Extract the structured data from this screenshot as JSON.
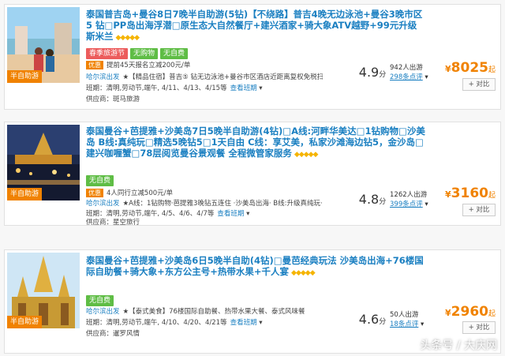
{
  "listings": [
    {
      "title": "泰国普吉岛+曼谷8日7晚半自助游(5钻)【不绕路】普吉4晚无边泳池+曼谷3晚市区5 钻□PP岛出海浮潜□原生态大自然餐厅+建兴酒家+骑大象ATV越野+99元升级斯米兰",
      "badge": "半自助游",
      "chips": [
        {
          "label": "春季旅游节",
          "color": "red"
        },
        {
          "label": "无购物",
          "color": "green"
        },
        {
          "label": "无自费",
          "color": "green"
        }
      ],
      "promo_tag": "优惠",
      "promo_text": "提前45天报名立减200元/单",
      "depart": "哈尔滨出发",
      "desc": "★【精品住宿】普吉⑤ 钻无边泳池+曼谷市区酒店近距离复权免税扫货!",
      "schedule_prefix": "班期：",
      "schedule": "清明,劳动节,端午, 4/11、4/13、4/15等",
      "schedule_link": "查看班期",
      "supplier_prefix": "供应商：",
      "supplier": "斑马旅游",
      "score": "4.9",
      "score_unit": "分",
      "travelers": "942人出游",
      "reviews": "298条点评",
      "price_cur": "¥",
      "price": "8025",
      "price_suffix": "起",
      "compare_label": "+ 对比"
    },
    {
      "title": "泰国曼谷+芭提雅+沙美岛7日5晚半自助游(4钻)□A线:河畔华美达□1钻购物□沙美岛 B线:真纯玩□精选5晚钻5□1天自由 C线：享艾美，私家沙滩海边钻5，金沙岛□建兴咖喱蟹□78层阅览曼谷景观餐 全程微管家服务",
      "badge": "半自助游",
      "chips": [
        {
          "label": "无自费",
          "color": "green"
        }
      ],
      "promo_tag": "优惠",
      "promo_text": "4人同行立减500元/单",
      "depart": "哈尔滨出发",
      "desc": "★A线：1钻购物·芭提雅3晚钻五连住 ·沙美岛出海· B线:升级真纯玩··1天自由·",
      "schedule_prefix": "班期：",
      "schedule": "清明,劳动节,端午, 4/5、4/6、4/7等",
      "schedule_link": "查看班期",
      "supplier_prefix": "供应商：",
      "supplier": "星空旅行",
      "score": "4.8",
      "score_unit": "分",
      "travelers": "1262人出游",
      "reviews": "399条点评",
      "price_cur": "¥",
      "price": "3160",
      "price_suffix": "起",
      "compare_label": "+ 对比"
    },
    {
      "title": "泰国曼谷+芭提雅+沙美岛6日5晚半自助(4钻)□曼芭经典玩法 沙美岛出海+76楼国际自助餐+骑大象+东方公主号+热带水果+千人宴",
      "badge": "半自助游",
      "chips": [
        {
          "label": "无自费",
          "color": "green"
        }
      ],
      "promo_tag": "",
      "promo_text": "",
      "depart": "哈尔滨出发",
      "desc": "★【泰式美食】76楼国际自助餐、热带水果大餐、泰式风味餐",
      "schedule_prefix": "班期：",
      "schedule": "清明,劳动节,端午, 4/10、4/20、4/21等",
      "schedule_link": "查看班期",
      "supplier_prefix": "供应商：",
      "supplier": "暹罗风情",
      "score": "4.6",
      "score_unit": "分",
      "travelers": "50人出游",
      "reviews": "18条点评",
      "price_cur": "¥",
      "price": "2960",
      "price_suffix": "起",
      "compare_label": "+ 对比"
    }
  ],
  "diamonds": "◆◆◆◆◆",
  "watermark": "头条号 / 大庆网",
  "colors": {
    "link": "#1a7fc1",
    "price": "#f08200",
    "green_chip": "#5fbd45",
    "red_chip": "#ec5c5c"
  }
}
